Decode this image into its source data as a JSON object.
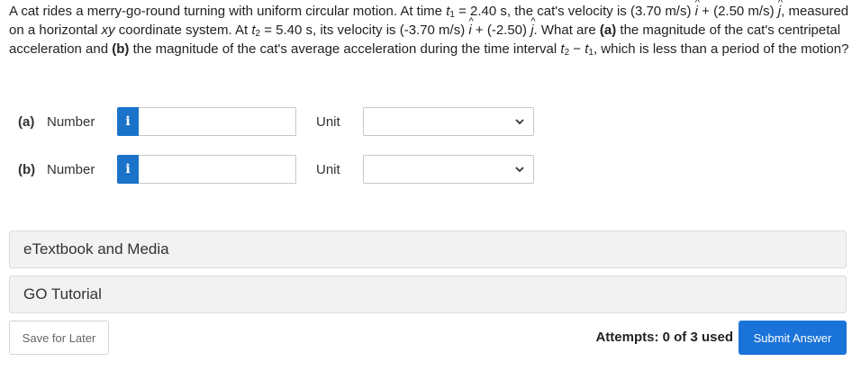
{
  "question": {
    "p1": "A cat rides a merry-go-round turning with uniform circular motion. At time ",
    "t1_var": "t",
    "t1_sub": "1",
    "p2": " = 2.40 s, the cat's velocity is (3.70 m/s) ",
    "i_hat": "i",
    "p3": " + (2.50 m/s) ",
    "j_hat": "j",
    "p4": ", measured on a horizontal ",
    "xy": "xy",
    "p5": " coordinate system. At ",
    "t2_var": "t",
    "t2_sub": "2",
    "p6": " = 5.40 s, its velocity is (-3.70 m/s) ",
    "p7": " + (-2.50) ",
    "p8": ". What are ",
    "a_tag": "(a)",
    "p9": " the magnitude of the cat's centripetal acceleration and ",
    "b_tag": "(b)",
    "p10": " the magnitude of the cat's average acceleration during the time interval ",
    "p11": " − ",
    "p12": ", which is less than a period of the motion?"
  },
  "rows": [
    {
      "label": "(a)",
      "kind": "Number",
      "info_icon": "i",
      "value": "",
      "unit_label": "Unit",
      "unit_value": ""
    },
    {
      "label": "(b)",
      "kind": "Number",
      "info_icon": "i",
      "value": "",
      "unit_label": "Unit",
      "unit_value": ""
    }
  ],
  "resources": {
    "etextbook": "eTextbook and Media",
    "go_tutorial": "GO Tutorial"
  },
  "footer": {
    "save_label": "Save for Later",
    "attempts": "Attempts: 0 of 3 used",
    "submit_label": "Submit Answer"
  },
  "colors": {
    "accent": "#1a73c8",
    "submit": "#1a73d9",
    "panel_bg": "#f2f2f2"
  },
  "icons": {
    "info": "info-icon",
    "dropdown": "chevron-down-icon"
  }
}
